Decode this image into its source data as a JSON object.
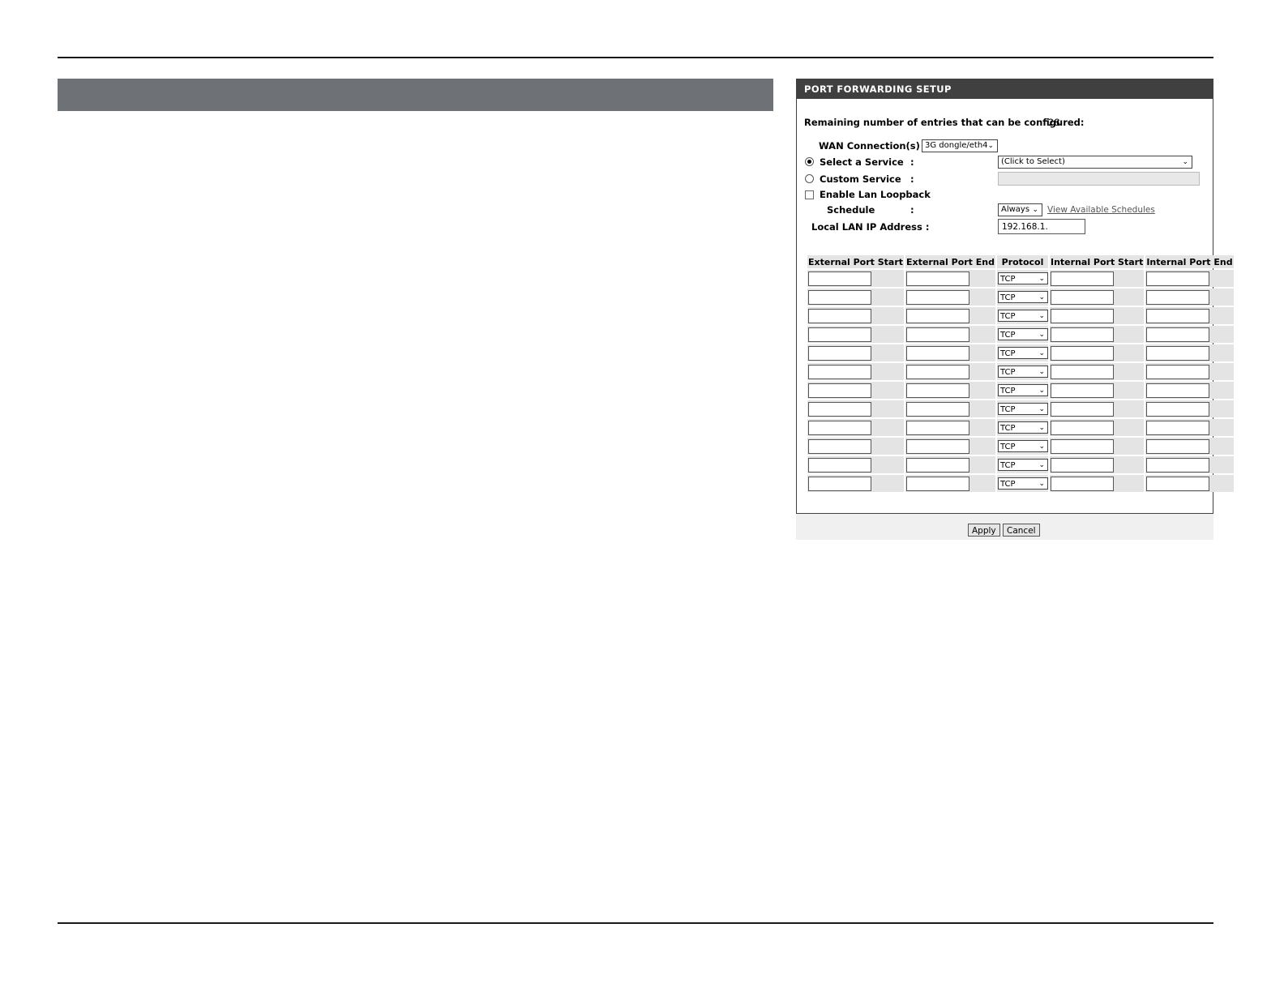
{
  "panel": {
    "title": "PORT FORWARDING SETUP",
    "remaining_label": "Remaining number of entries that can be configured:",
    "remaining_value": "28",
    "wan_label": "WAN Connection(s)  :",
    "wan_value": "3G dongle/eth4",
    "select_service_label": "Select a Service",
    "select_service_value": "(Click to Select)",
    "select_service_checked": true,
    "custom_service_label": "Custom Service",
    "colon": ":",
    "loopback_label": "Enable Lan Loopback",
    "schedule_label": "Schedule",
    "schedule_value": "Always",
    "view_schedules_link": "View Available Schedules",
    "local_ip_label": "Local LAN IP Address :",
    "local_ip_value": "192.168.1."
  },
  "table": {
    "headers": [
      "External Port Start",
      "External Port End",
      "Protocol",
      "Internal Port Start",
      "Internal Port End"
    ],
    "rows": [
      "TCP",
      "TCP",
      "TCP",
      "TCP",
      "TCP",
      "TCP",
      "TCP",
      "TCP",
      "TCP",
      "TCP",
      "TCP",
      "TCP"
    ]
  },
  "buttons": {
    "apply": "Apply",
    "cancel": "Cancel"
  },
  "icons": {
    "dropdown": "chevron-down-icon"
  }
}
